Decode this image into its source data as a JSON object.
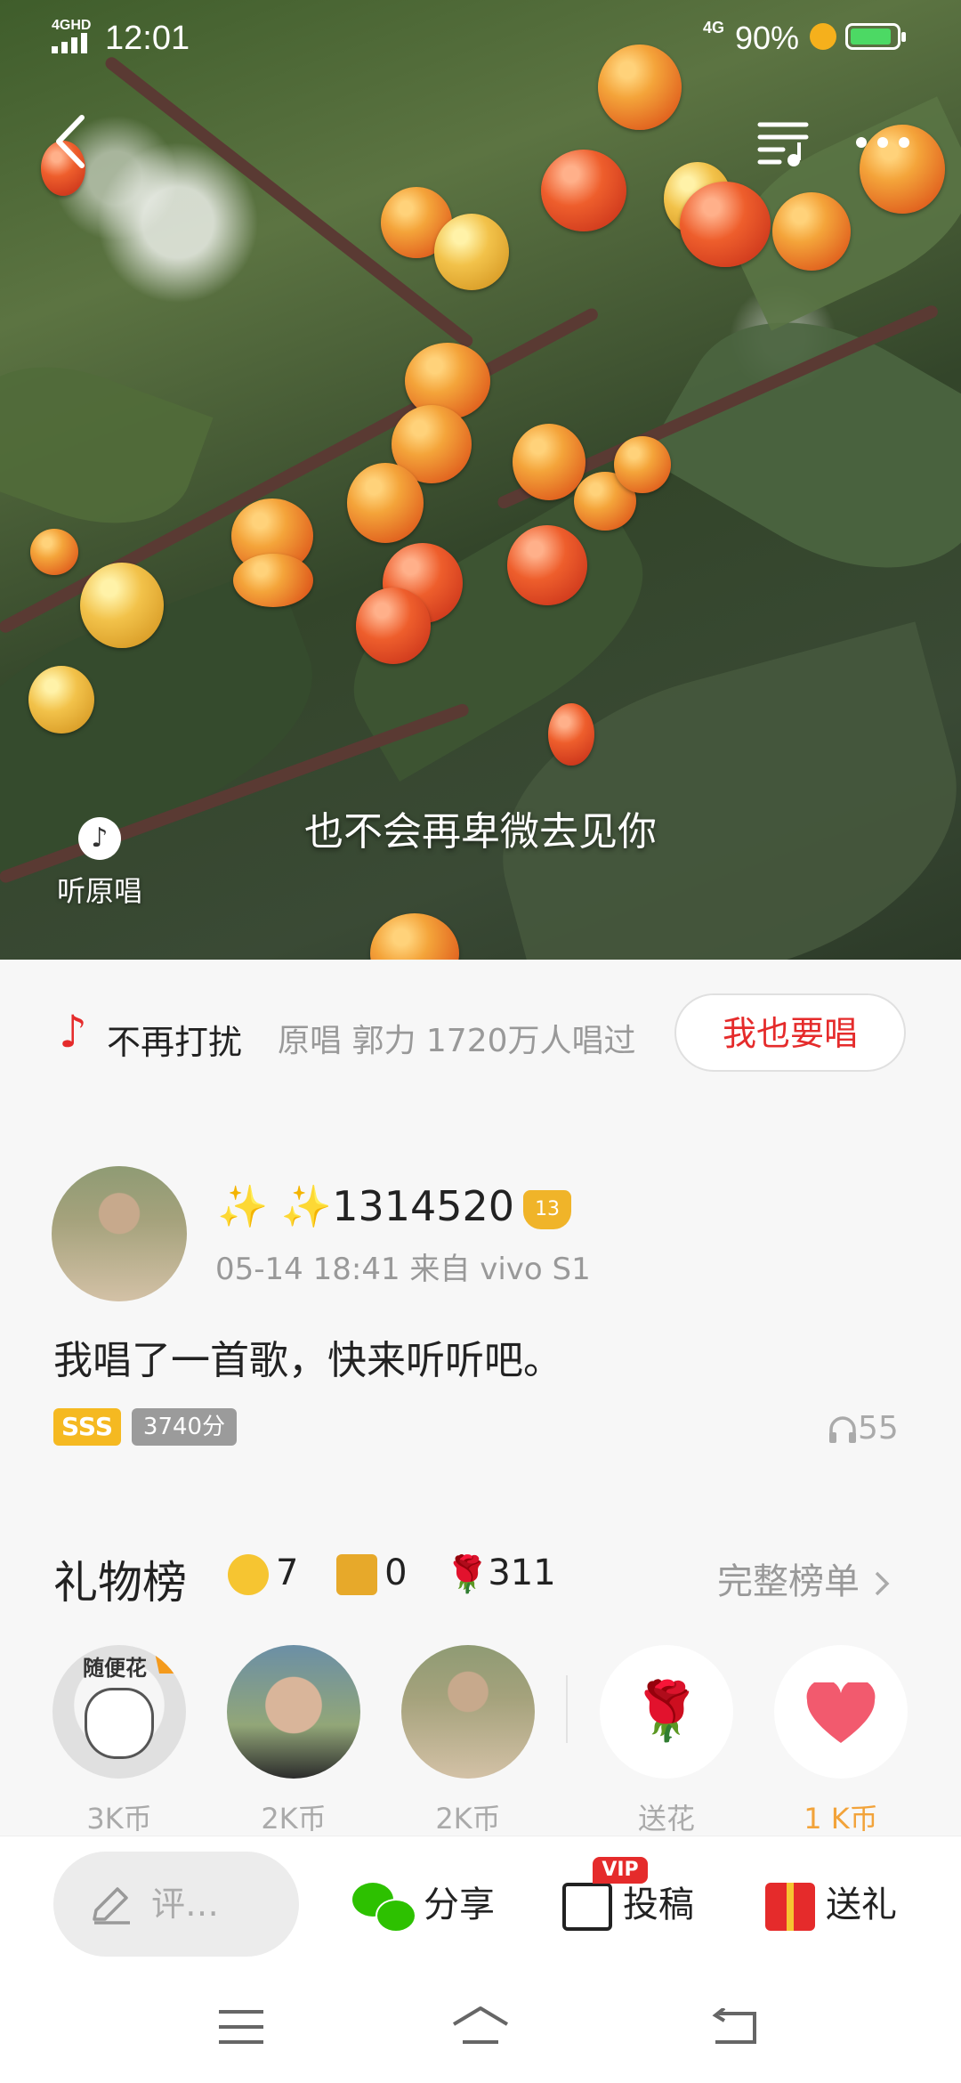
{
  "status_bar": {
    "network": "4GHD",
    "time": "12:01",
    "data_type": "4G",
    "battery": "90%",
    "battery_level": 0.9
  },
  "player": {
    "lyric": "也不会再卑微去见你",
    "original_label": "听原唱",
    "icons": [
      "back-arrow-icon",
      "playlist-icon",
      "more-icon",
      "music-note-icon"
    ]
  },
  "song": {
    "title": "不再打扰",
    "meta": "原唱 郭力 1720万人唱过",
    "sing_button": "我也要唱"
  },
  "post": {
    "username": "1314520",
    "sparkles": "✨ ✨",
    "level_badge": "13",
    "time_source": "05-14 18:41 来自 vivo S1",
    "text": "我唱了一首歌，快来听听吧。",
    "grade": "SSS",
    "score": "3740分",
    "listen_count": "55"
  },
  "gifts": {
    "title": "礼物榜",
    "coins": "7",
    "boxes": "0",
    "flowers": "311",
    "full_list": "完整榜单",
    "gifters": [
      {
        "caption": "随便花",
        "amount": "3K币"
      },
      {
        "amount": "2K币"
      },
      {
        "amount": "2K币"
      }
    ],
    "items": [
      {
        "label": "送花",
        "icon": "rose-icon"
      },
      {
        "label": "1 K币",
        "icon": "heart-icon"
      }
    ]
  },
  "actions": {
    "comment_placeholder": "评…",
    "share": "分享",
    "submit": "投稿",
    "vip_tag": "VIP",
    "gift": "送礼"
  },
  "colors": {
    "accent_red": "#e52b2b",
    "gold": "#f5b921",
    "wechat_green": "#2dc100"
  }
}
